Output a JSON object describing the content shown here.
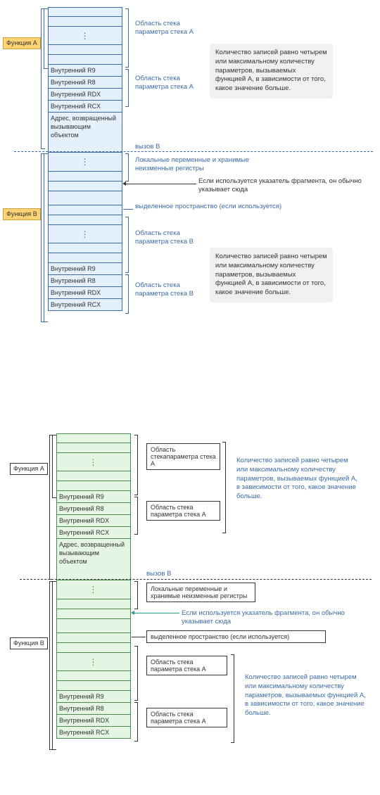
{
  "top": {
    "funcA": "Функция A",
    "funcB": "Функция B",
    "regs": {
      "r9": "Внутренний R9",
      "r8": "Внутренний R8",
      "rdx": "Внутренний RDX",
      "rcx": "Внутренний RCX"
    },
    "caller_ret": "Адрес, возвращенный вызывающим объектом",
    "call_b": "вызов B",
    "annot_stackA_1": "Область стека параметра стека A",
    "annot_stackA_2": "Область стека параметра стека A",
    "annot_stackB_1": "Область стека параметра стека B",
    "annot_stackB_2": "Область стека параметра стека B",
    "annot_locals": "Локальные переменные и хранимые неизменные регистры",
    "annot_fp": "Если используется указатель фрагмента, он обычно указывает сюда",
    "annot_alloca": "выделенное пространство (если используется)",
    "sidenote": "Количество записей равно четырем или максимальному количеству параметров, вызываемых функцией A, в зависимости от того, какое значение больше."
  },
  "bottom": {
    "funcA": "Функция A",
    "funcB": "Функция B",
    "regs": {
      "r9": "Внутренний R9",
      "r8": "Внутренний R8",
      "rdx": "Внутренний RDX",
      "rcx": "Внутренний RCX"
    },
    "caller_ret": "Адрес, возвращенный вызывающим объектом",
    "call_b": "вызов B",
    "annot_stackA_1": "Область стекапараметра стека A",
    "annot_stackA_2": "Область стека параметра стека A",
    "annot_stackA_3": "Область стека параметра стека A",
    "annot_stackA_4": "Область стека параметра стека A",
    "annot_locals": "Локальные переменные и хранимые неизменные регистры",
    "annot_fp": "Если используется указатель фрагмента, он обычно указывает сюда",
    "annot_alloca": "выделенное пространство (если используется)",
    "sidenote": "Количество записей равно четырем или максимальному количеству параметров, вызываемых функцией A, в зависимости от того, какое значение больше."
  }
}
